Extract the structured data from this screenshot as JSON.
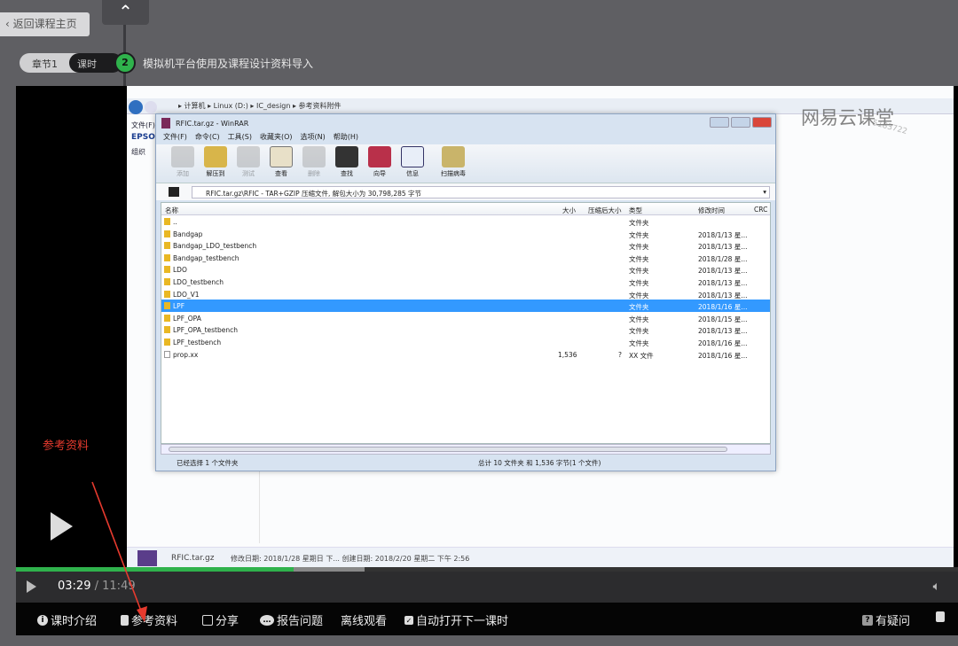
{
  "header": {
    "back_label": "返回课程主页",
    "chapter": "章节1",
    "lesson_tab": "课时",
    "lesson_number": "2",
    "lesson_title": "模拟机平台使用及课程设计资料导入"
  },
  "explorer": {
    "path": "▸ 计算机 ▸ Linux (D:) ▸ IC_design ▸ 参考资料附件",
    "left_labels": [
      "文件(F)",
      "EPSO",
      "组织"
    ],
    "file_name": "RFIC.tar.gz",
    "file_meta": "修改日期: 2018/1/28 星期日 下...  创建日期: 2018/2/20 星期二 下午 2:56"
  },
  "watermark": {
    "brand": "网易云课堂",
    "sub": "5183722"
  },
  "winrar": {
    "title": "RFIC.tar.gz - WinRAR",
    "menu": [
      "文件(F)",
      "命令(C)",
      "工具(S)",
      "收藏夹(O)",
      "选项(N)",
      "帮助(H)"
    ],
    "tools": [
      {
        "label": "添加",
        "icon": "add-icon",
        "disabled": true
      },
      {
        "label": "解压到",
        "icon": "extract-icon"
      },
      {
        "label": "测试",
        "icon": "test-icon",
        "disabled": true
      },
      {
        "label": "查看",
        "icon": "view-icon"
      },
      {
        "label": "删除",
        "icon": "delete-icon",
        "disabled": true
      },
      {
        "label": "查找",
        "icon": "find-icon"
      },
      {
        "label": "向导",
        "icon": "wizard-icon"
      },
      {
        "label": "信息",
        "icon": "info-icon"
      },
      {
        "label": "扫描病毒",
        "icon": "virus-scan-icon"
      }
    ],
    "address": "RFIC.tar.gz\\RFIC - TAR+GZIP 压缩文件, 解包大小为 30,798,285 字节",
    "columns": {
      "name": "名称",
      "size": "大小",
      "packed": "压缩后大小",
      "type": "类型",
      "modified": "修改时间",
      "crc": "CRC"
    },
    "rows": [
      {
        "name": "..",
        "size": "",
        "packed": "",
        "type": "文件夹",
        "date": ""
      },
      {
        "name": "Bandgap",
        "size": "",
        "packed": "",
        "type": "文件夹",
        "date": "2018/1/13 星..."
      },
      {
        "name": "Bandgap_LDO_testbench",
        "size": "",
        "packed": "",
        "type": "文件夹",
        "date": "2018/1/13 星..."
      },
      {
        "name": "Bandgap_testbench",
        "size": "",
        "packed": "",
        "type": "文件夹",
        "date": "2018/1/28 星..."
      },
      {
        "name": "LDO",
        "size": "",
        "packed": "",
        "type": "文件夹",
        "date": "2018/1/13 星..."
      },
      {
        "name": "LDO_testbench",
        "size": "",
        "packed": "",
        "type": "文件夹",
        "date": "2018/1/13 星..."
      },
      {
        "name": "LDO_V1",
        "size": "",
        "packed": "",
        "type": "文件夹",
        "date": "2018/1/13 星..."
      },
      {
        "name": "LPF",
        "size": "",
        "packed": "",
        "type": "文件夹",
        "date": "2018/1/16 星...",
        "selected": true
      },
      {
        "name": "LPF_OPA",
        "size": "",
        "packed": "",
        "type": "文件夹",
        "date": "2018/1/15 星..."
      },
      {
        "name": "LPF_OPA_testbench",
        "size": "",
        "packed": "",
        "type": "文件夹",
        "date": "2018/1/13 星..."
      },
      {
        "name": "LPF_testbench",
        "size": "",
        "packed": "",
        "type": "文件夹",
        "date": "2018/1/16 星..."
      },
      {
        "name": "prop.xx",
        "size": "1,536",
        "packed": "?",
        "type": "XX 文件",
        "date": "2018/1/16 星..."
      }
    ],
    "status_left": "已经选择 1 个文件夹",
    "status_right": "总计 10 文件夹 和 1,536 字节(1 个文件)"
  },
  "player": {
    "current_time": "03:29",
    "separator": "/",
    "duration": "11:49",
    "progress_percent": 29.5,
    "buffered_percent": 37
  },
  "bottom_bar": {
    "intro": "课时介绍",
    "materials": "参考资料",
    "share": "分享",
    "report": "报告问题",
    "offline": "离线观看",
    "autoplay": "自动打开下一课时",
    "question": "有疑问"
  },
  "annotation": {
    "text": "参考资料",
    "color": "#e63a2e"
  },
  "colors": {
    "accent_green": "#2fb24c",
    "selection": "#3399ff"
  }
}
